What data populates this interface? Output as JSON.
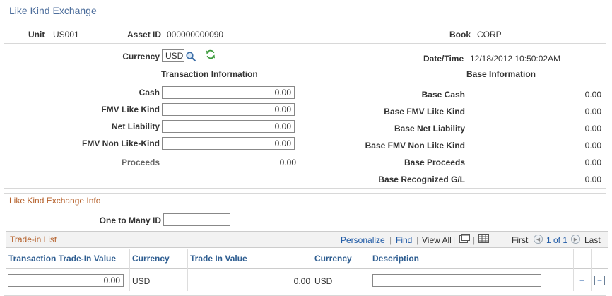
{
  "page": {
    "title": "Like Kind Exchange"
  },
  "header": {
    "unit_label": "Unit",
    "unit_value": "US001",
    "asset_label": "Asset ID",
    "asset_value": "000000000090",
    "book_label": "Book",
    "book_value": "CORP"
  },
  "currency": {
    "label": "Currency",
    "value": "USD",
    "lookup_icon": "magnifier-icon",
    "refresh_icon": "refresh-icon"
  },
  "datetime": {
    "label": "Date/Time",
    "value": "12/18/2012 10:50:02AM"
  },
  "transaction": {
    "heading": "Transaction Information",
    "cash_label": "Cash",
    "cash_value": "0.00",
    "fmv_label": "FMV Like Kind",
    "fmv_value": "0.00",
    "liability_label": "Net Liability",
    "liability_value": "0.00",
    "fmv_non_label": "FMV Non Like-Kind",
    "fmv_non_value": "0.00",
    "proceeds_label": "Proceeds",
    "proceeds_value": "0.00"
  },
  "base": {
    "heading": "Base Information",
    "cash_label": "Base Cash",
    "cash_value": "0.00",
    "fmv_label": "Base FMV Like Kind",
    "fmv_value": "0.00",
    "liability_label": "Base Net Liability",
    "liability_value": "0.00",
    "fmv_non_label": "Base FMV Non Like Kind",
    "fmv_non_value": "0.00",
    "proceeds_label": "Base Proceeds",
    "proceeds_value": "0.00",
    "recognized_label": "Base Recognized G/L",
    "recognized_value": "0.00"
  },
  "lke_info": {
    "title": "Like Kind Exchange Info",
    "one_to_many_label": "One to Many ID",
    "one_to_many_value": ""
  },
  "trade_in": {
    "title": "Trade-in List",
    "personalize": "Personalize",
    "find": "Find",
    "view_all": "View All",
    "separator": "|",
    "first": "First",
    "range": "1 of 1",
    "last": "Last",
    "columns": [
      "Transaction Trade-In Value",
      "Currency",
      "Trade In Value",
      "Currency",
      "Description"
    ],
    "rows": [
      {
        "trans_value": "0.00",
        "currency": "USD",
        "trade_value": "0.00",
        "currency2": "USD",
        "description": ""
      }
    ],
    "add_symbol": "+",
    "remove_symbol": "−"
  },
  "colors": {
    "title": "#4d6e9c",
    "section": "#b5602a",
    "link": "#1f5aa6",
    "column_header": "#2f5e91"
  }
}
